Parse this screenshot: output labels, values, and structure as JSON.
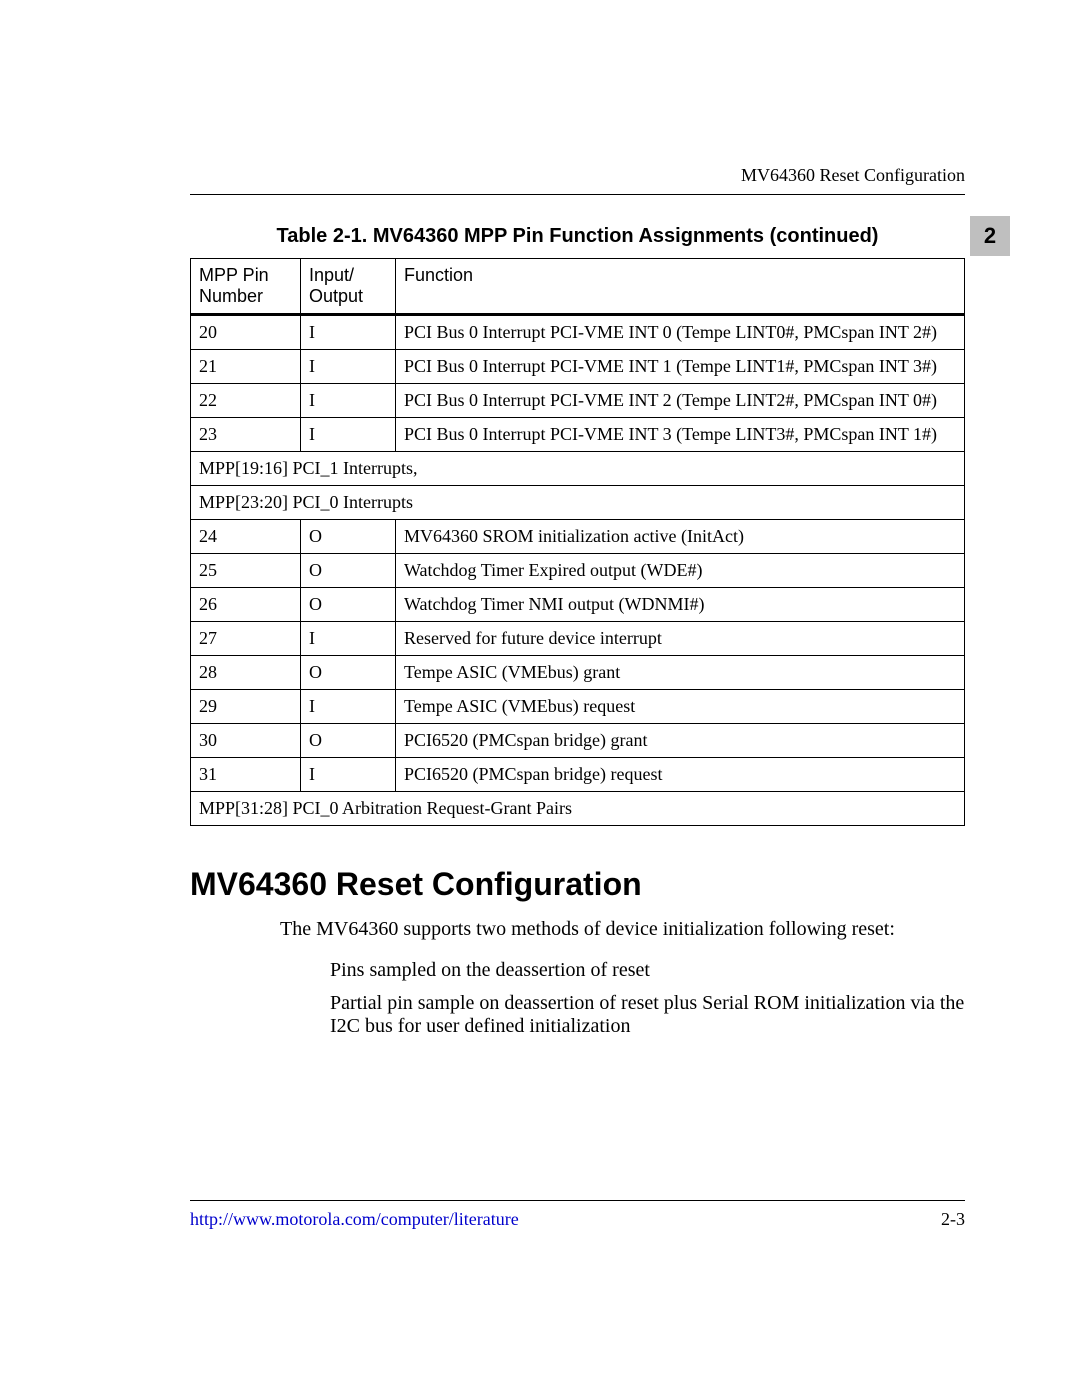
{
  "header": {
    "running_title": "MV64360 Reset Configuration"
  },
  "chapter_tab": "2",
  "table": {
    "caption": "Table 2-1. MV64360 MPP Pin Function Assignments (continued)",
    "headers": {
      "pin": "MPP Pin Number",
      "io": "Input/ Output",
      "func": "Function"
    },
    "rows": [
      {
        "pin": "20",
        "io": "I",
        "func": "PCI Bus 0 Interrupt PCI-VME INT 0 (Tempe LINT0#, PMCspan INT 2#)"
      },
      {
        "pin": "21",
        "io": "I",
        "func": "PCI Bus 0 Interrupt PCI-VME INT 1 (Tempe LINT1#, PMCspan INT 3#)"
      },
      {
        "pin": "22",
        "io": "I",
        "func": "PCI Bus 0 Interrupt PCI-VME INT 2 (Tempe LINT2#, PMCspan INT 0#)"
      },
      {
        "pin": "23",
        "io": "I",
        "func": "PCI Bus 0 Interrupt PCI-VME INT 3 (Tempe LINT3#, PMCspan INT 1#)"
      },
      {
        "span": "MPP[19:16] PCI_1 Interrupts,"
      },
      {
        "span": "MPP[23:20] PCI_0 Interrupts"
      },
      {
        "pin": "24",
        "io": "O",
        "func": "MV64360 SROM initialization active (InitAct)"
      },
      {
        "pin": "25",
        "io": "O",
        "func": "Watchdog Timer Expired output (WDE#)"
      },
      {
        "pin": "26",
        "io": "O",
        "func": "Watchdog Timer NMI output (WDNMI#)"
      },
      {
        "pin": "27",
        "io": "I",
        "func": "Reserved for future device interrupt"
      },
      {
        "pin": "28",
        "io": "O",
        "func": "Tempe ASIC (VMEbus) grant"
      },
      {
        "pin": "29",
        "io": "I",
        "func": "Tempe ASIC (VMEbus) request"
      },
      {
        "pin": "30",
        "io": "O",
        "func": "PCI6520 (PMCspan bridge) grant"
      },
      {
        "pin": "31",
        "io": "I",
        "func": "PCI6520 (PMCspan bridge) request"
      },
      {
        "span": "MPP[31:28] PCI_0 Arbitration Request-Grant Pairs"
      }
    ]
  },
  "section": {
    "heading": "MV64360 Reset Configuration",
    "intro": "The MV64360 supports two methods of device initialization following reset:",
    "items": [
      "Pins sampled on the deassertion of reset",
      "Partial pin sample on deassertion of reset plus Serial ROM initialization via the I2C bus for user defined initialization"
    ]
  },
  "footer": {
    "link": "http://www.motorola.com/computer/literature",
    "page": "2-3"
  }
}
